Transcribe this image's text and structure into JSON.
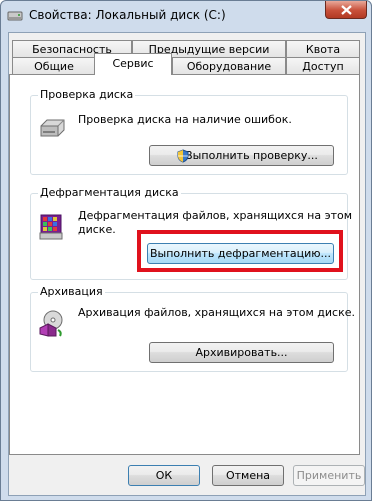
{
  "window": {
    "title": "Свойства: Локальный диск (C:)"
  },
  "tabs": {
    "row1": [
      "Безопасность",
      "Предыдущие версии",
      "Квота"
    ],
    "row2": [
      "Общие",
      "Сервис",
      "Оборудование",
      "Доступ"
    ],
    "active": "Сервис"
  },
  "check": {
    "label": "Проверка диска",
    "description": "Проверка диска на наличие ошибок.",
    "button": "Выполнить проверку..."
  },
  "defrag": {
    "label": "Дефрагментация диска",
    "description_line1": "Дефрагментация файлов, хранящихся на этом",
    "description_line2": "диске.",
    "button": "Выполнить дефрагментацию..."
  },
  "backup": {
    "label": "Архивация",
    "description": "Архивация файлов, хранящихся на этом диске.",
    "button": "Архивировать..."
  },
  "footer": {
    "ok": "ОК",
    "cancel": "Отмена",
    "apply": "Применить"
  },
  "colors": {
    "highlight": "#e0111d",
    "window_frame": "#cfdcec"
  }
}
